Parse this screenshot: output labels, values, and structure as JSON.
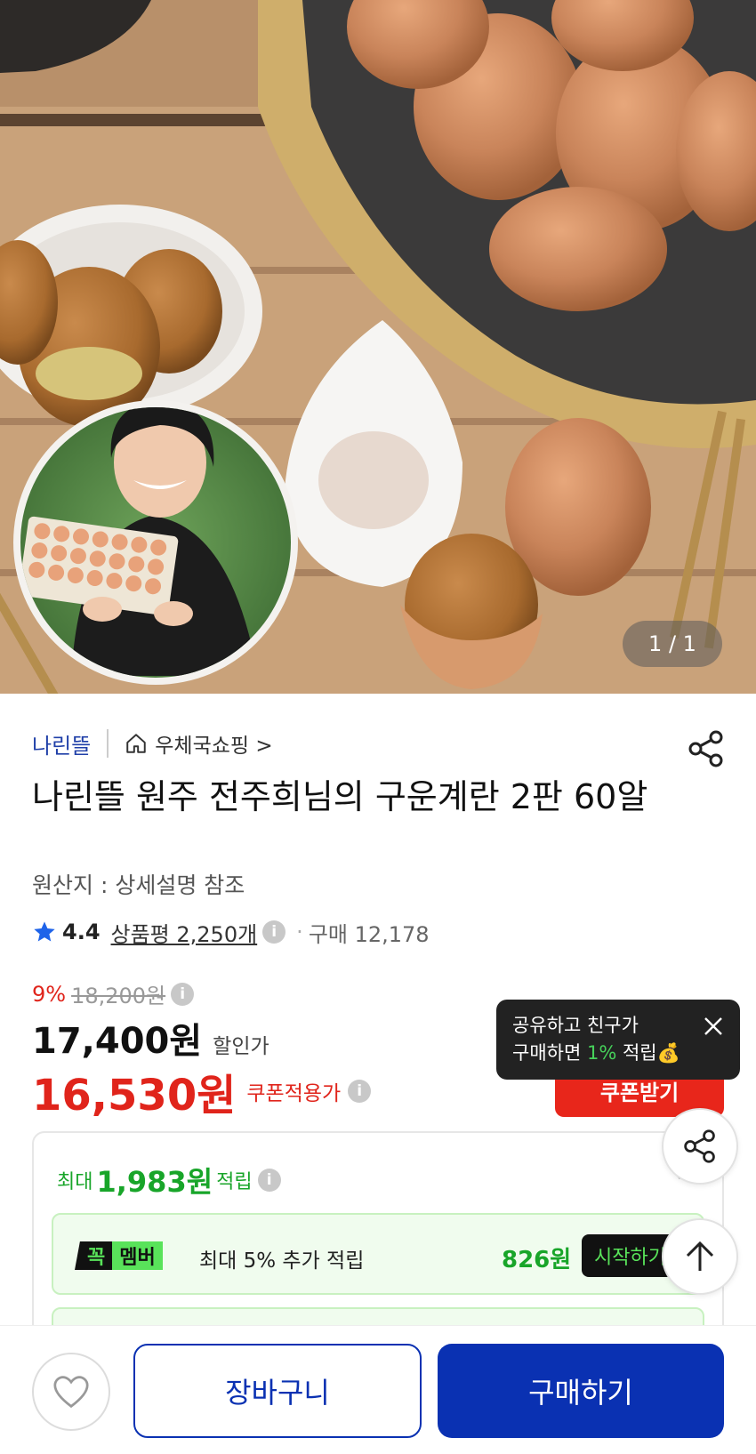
{
  "gallery": {
    "pager": "1 / 1"
  },
  "store": {
    "seller": "나린뜰",
    "channel": "우체국쇼핑 >"
  },
  "product": {
    "title": "나린뜰 원주 전주희님의 구운계란 2판 60알",
    "origin": "원산지 : 상세설명 참조"
  },
  "rating": {
    "score": "4.4",
    "reviews": "상품평 2,250개",
    "purchases": "구매 12,178"
  },
  "price": {
    "discount_rate": "9%",
    "original": "18,200원",
    "sale": "17,400원",
    "sale_label": "할인가",
    "coupon": "16,530원",
    "coupon_label": "쿠폰적용가",
    "coupon_button": "쿠폰받기"
  },
  "tooltip": {
    "line1": "공유하고 친구가",
    "line2_prefix": "구매하면 ",
    "line2_rate": "1%",
    "line2_suffix": " 적립💰"
  },
  "rewards": {
    "prefix": "최대",
    "amount": "1,983원",
    "suffix": "적립",
    "member_badge_a": "꼭",
    "member_badge_b": "멤버",
    "member_text": "최대 5% 추가 적립",
    "member_amount": "826원",
    "member_button": "시작하기"
  },
  "bottom": {
    "cart": "장바구니",
    "buy": "구매하기"
  },
  "colors": {
    "brand_blue": "#0a31b2",
    "sale_red": "#e0241b",
    "reward_green": "#18a529"
  },
  "icons": [
    "home-icon",
    "share-icon",
    "star-icon",
    "info-icon",
    "close-icon",
    "chevron-down-icon",
    "arrow-up-icon",
    "heart-icon"
  ]
}
